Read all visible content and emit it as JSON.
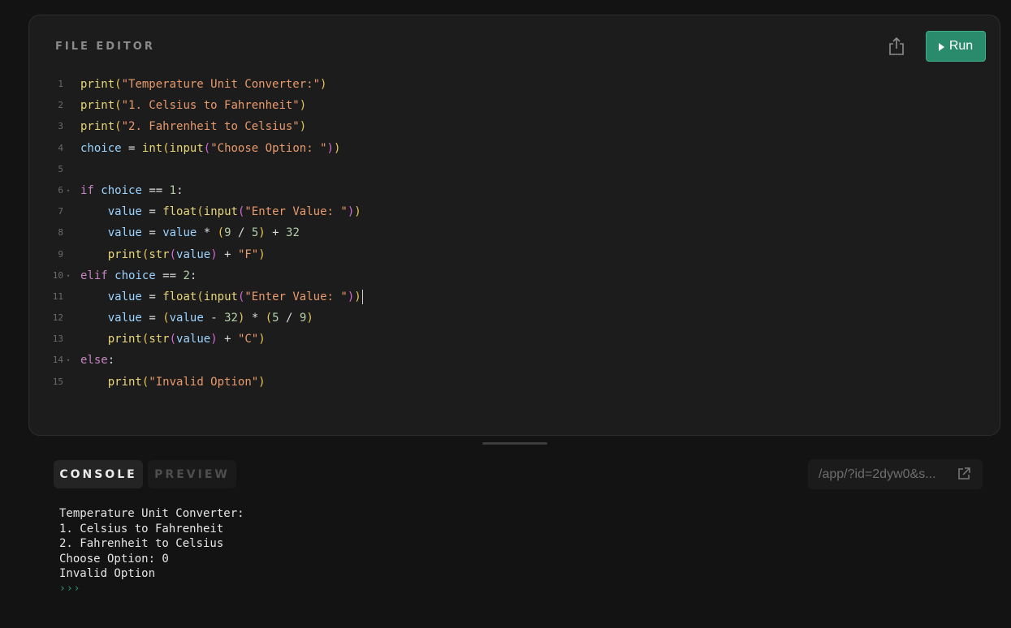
{
  "editor": {
    "title": "FILE EDITOR",
    "run_label": "Run",
    "share_icon": "share-icon",
    "run_icon": "play-icon",
    "lines": [
      {
        "no": "1",
        "fold": "",
        "text": "print(\"Temperature Unit Converter:\")"
      },
      {
        "no": "2",
        "fold": "",
        "text": "print(\"1. Celsius to Fahrenheit\")"
      },
      {
        "no": "3",
        "fold": "",
        "text": "print(\"2. Fahrenheit to Celsius\")"
      },
      {
        "no": "4",
        "fold": "",
        "text": "choice = int(input(\"Choose Option: \"))"
      },
      {
        "no": "5",
        "fold": "",
        "text": ""
      },
      {
        "no": "6",
        "fold": "▾",
        "text": "if choice == 1:"
      },
      {
        "no": "7",
        "fold": "",
        "text": "    value = float(input(\"Enter Value: \"))"
      },
      {
        "no": "8",
        "fold": "",
        "text": "    value = value * (9 / 5) + 32"
      },
      {
        "no": "9",
        "fold": "",
        "text": "    print(str(value) + \"F\")"
      },
      {
        "no": "10",
        "fold": "▾",
        "text": "elif choice == 2:"
      },
      {
        "no": "11",
        "fold": "",
        "text": "    value = float(input(\"Enter Value: \"))"
      },
      {
        "no": "12",
        "fold": "",
        "text": "    value = (value - 32) * (5 / 9)"
      },
      {
        "no": "13",
        "fold": "",
        "text": "    print(str(value) + \"C\")"
      },
      {
        "no": "14",
        "fold": "▾",
        "text": "else:"
      },
      {
        "no": "15",
        "fold": "",
        "text": "    print(\"Invalid Option\")"
      }
    ],
    "cursor_line": 11
  },
  "tabs": {
    "console": "CONSOLE",
    "preview": "PREVIEW",
    "active": "console"
  },
  "url": {
    "text": "/app/?id=2dyw0&s...",
    "icon": "external-link-icon"
  },
  "console": {
    "output": [
      "Temperature Unit Converter:",
      "1. Celsius to Fahrenheit",
      "2. Fahrenheit to Celsius",
      "Choose Option: 0",
      "Invalid Option"
    ],
    "prompt": "›››"
  },
  "colors": {
    "run_button": "#2a8a6c",
    "prompt": "#2f9a75",
    "keyword": "#c586c0",
    "function": "#e8d67a",
    "string": "#e89a6c",
    "variable": "#9cd4ff"
  }
}
